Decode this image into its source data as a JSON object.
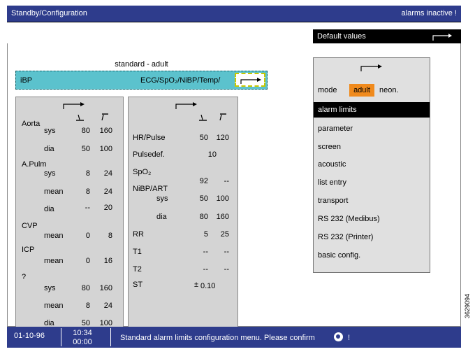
{
  "title_bar": {
    "title": "Standby/Configuration",
    "alarm_status": "alarms inactive !"
  },
  "default_values_label": "Default values",
  "profile_label": "standard - adult",
  "ibp_bar": {
    "left": "iBP",
    "right": "ECG/SpO₂/NiBP/Temp/"
  },
  "left_table": {
    "rows": [
      {
        "group": "Aorta",
        "sub": "sys",
        "low": "80",
        "high": "160"
      },
      {
        "group": "",
        "sub": "dia",
        "low": "50",
        "high": "100"
      },
      {
        "group": "A.Pulm",
        "sub": "sys",
        "low": "8",
        "high": "24"
      },
      {
        "group": "",
        "sub": "mean",
        "low": "8",
        "high": "24"
      },
      {
        "group": "",
        "sub": "dia",
        "low": "--",
        "high": "20"
      },
      {
        "group": "CVP",
        "sub": "mean",
        "low": "0",
        "high": "8"
      },
      {
        "group": "ICP",
        "sub": "mean",
        "low": "0",
        "high": "16"
      },
      {
        "group": "?",
        "sub": "sys",
        "low": "80",
        "high": "160"
      },
      {
        "group": "",
        "sub": "mean",
        "low": "8",
        "high": "24"
      },
      {
        "group": "",
        "sub": "dia",
        "low": "50",
        "high": "100"
      }
    ]
  },
  "right_table": {
    "hr_label": "HR/Pulse",
    "hr_low": "50",
    "hr_high": "120",
    "pulsedef_label": "Pulsedef.",
    "pulsedef_value": "10",
    "spo2_label": "SpO₂",
    "spo2_low": "92",
    "spo2_high": "--",
    "nibp_label": "NiBP/ART",
    "nibp_sys_label": "sys",
    "nibp_sys_low": "50",
    "nibp_sys_high": "100",
    "nibp_dia_label": "dia",
    "nibp_dia_low": "80",
    "nibp_dia_high": "160",
    "rr_label": "RR",
    "rr_low": "5",
    "rr_high": "25",
    "t1_label": "T1",
    "t1_low": "--",
    "t1_high": "--",
    "t2_label": "T2",
    "t2_low": "--",
    "t2_high": "--",
    "st_label": "ST",
    "st_pm": "±",
    "st_value": "0.10"
  },
  "menu": {
    "mode_label": "mode",
    "mode_adult": "adult",
    "mode_neon": "neon.",
    "items": [
      "alarm limits",
      "parameter",
      "screen",
      "acoustic",
      "list entry",
      "transport",
      "RS 232 (Medibus)",
      "RS 232    (Printer)",
      "basic config."
    ]
  },
  "status_bar": {
    "date": "01-10-96",
    "time": "10:34",
    "duration": "00:00",
    "message": "Standard alarm limits configuration menu. Please confirm",
    "exclaim": "!"
  },
  "side_code": "3629094",
  "colors": {
    "title_bar": "#2e3c8c",
    "ibp_bar": "#5bc2cd",
    "mode_highlight": "#f08a1c",
    "selected_item": "#000000"
  }
}
